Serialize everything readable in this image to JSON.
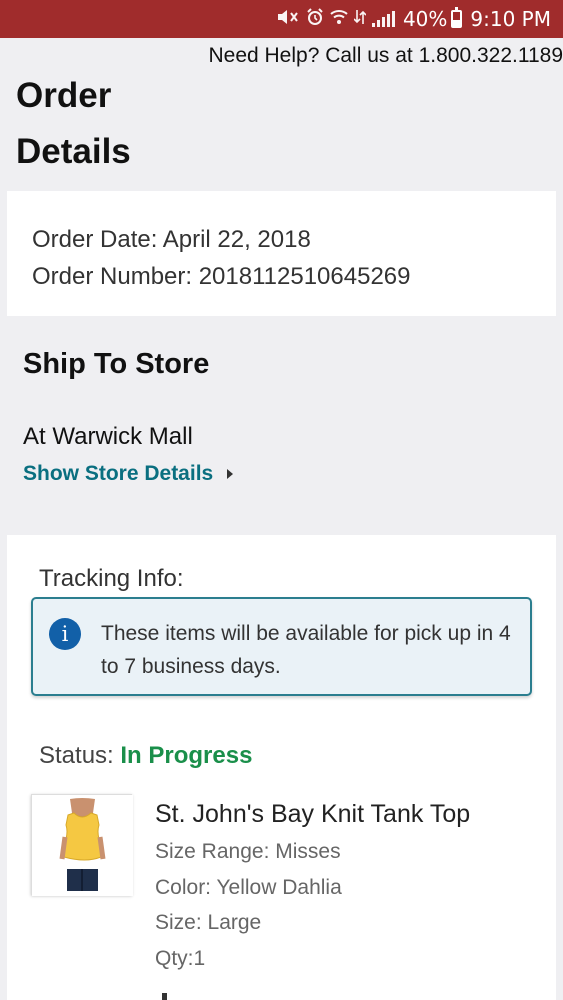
{
  "status_bar": {
    "battery_percent": "40%",
    "battery_level": 0.4,
    "time": "9:10 PM",
    "icons": [
      "mute-icon",
      "alarm-icon",
      "wifi-icon",
      "data-icon",
      "signal-icon",
      "battery-icon"
    ]
  },
  "help": {
    "text": "Need Help? Call us at 1.800.322.1189"
  },
  "page": {
    "title": "Order Details"
  },
  "order": {
    "date_line": "Order Date: April 22, 2018",
    "number_line": "Order Number: 2018112510645269"
  },
  "ship": {
    "title": "Ship To Store",
    "store_name": "At Warwick Mall",
    "details_link": "Show Store Details"
  },
  "tracking": {
    "label": "Tracking Info:",
    "info_message": "These items will be available for pick up in 4 to 7 business days.",
    "status_label": "Status:",
    "status_value": "In Progress",
    "status_color": "#1a8f4a"
  },
  "product": {
    "name": "St. John's Bay Knit Tank Top",
    "size_range": "Size Range: Misses",
    "color": "Color: Yellow Dahlia",
    "size": "Size: Large",
    "qty": "Qty:1"
  },
  "colors": {
    "status_bar": "#a02c2c",
    "link": "#0a6f80",
    "info_border": "#2b7e8f",
    "info_icon": "#1260a8"
  }
}
